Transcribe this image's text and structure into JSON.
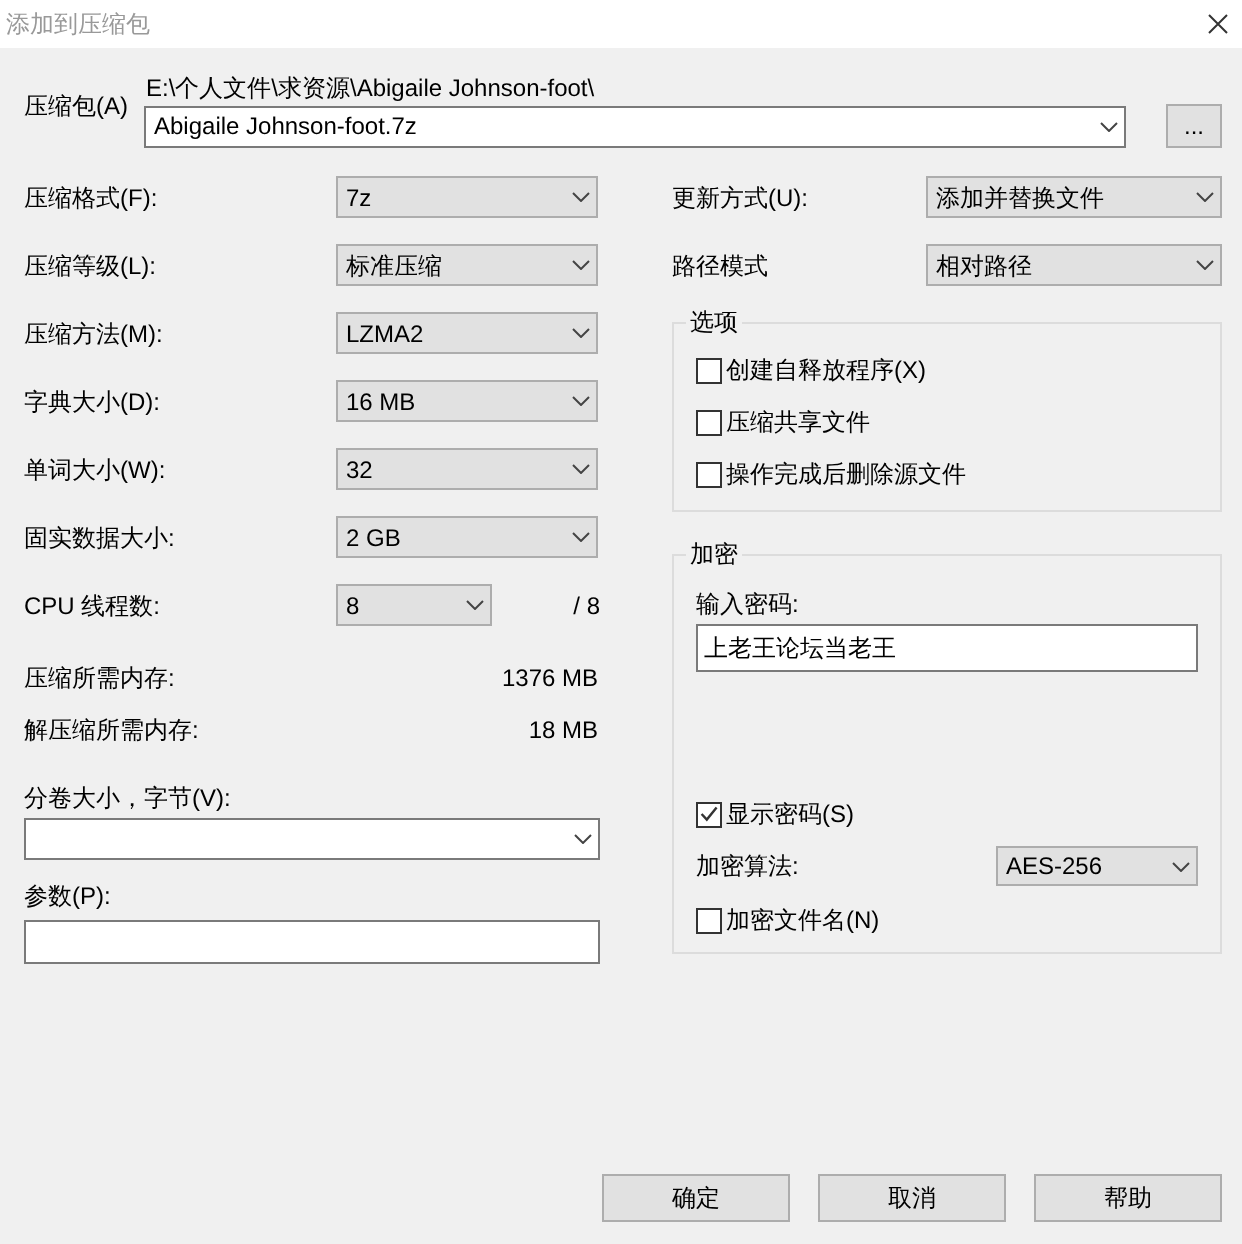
{
  "window": {
    "title": "添加到压缩包"
  },
  "archive": {
    "label": "压缩包(A)",
    "folder": "E:\\个人文件\\求资源\\Abigaile Johnson-foot\\",
    "file_name": "Abigaile Johnson-foot.7z",
    "browse_button": "..."
  },
  "compression_settings": [
    {
      "label": "压缩格式(F):",
      "value": "7z"
    },
    {
      "label": "压缩等级(L):",
      "value": "标准压缩"
    },
    {
      "label": "压缩方法(M):",
      "value": "LZMA2"
    },
    {
      "label": "字典大小(D):",
      "value": "16 MB"
    },
    {
      "label": "单词大小(W):",
      "value": "32"
    },
    {
      "label": "固实数据大小:",
      "value": "2 GB"
    },
    {
      "label": "CPU 线程数:",
      "value": "8",
      "maximum": "/ 8"
    }
  ],
  "memory_usage": [
    {
      "label": "压缩所需内存:",
      "value": "1376 MB"
    },
    {
      "label": "解压缩所需内存:",
      "value": "18 MB"
    }
  ],
  "split_volume": {
    "label": "分卷大小，字节(V):"
  },
  "parameters": {
    "label": "参数(P):"
  },
  "archive_settings": [
    {
      "label": "更新方式(U):",
      "value": "添加并替换文件"
    },
    {
      "label": "路径模式",
      "value": "相对路径"
    }
  ],
  "options": {
    "title": "选项",
    "items": [
      {
        "label": "创建自释放程序(X)",
        "checked": false
      },
      {
        "label": "压缩共享文件",
        "checked": false
      },
      {
        "label": "操作完成后删除源文件",
        "checked": false
      }
    ]
  },
  "encryption": {
    "title": "加密",
    "password_label": "输入密码:",
    "password": "上老王论坛当老王",
    "show_password": {
      "label": "显示密码(S)",
      "checked": true
    },
    "method_label": "加密算法:",
    "method": "AES-256",
    "encrypt_file_names": {
      "label": "加密文件名(N)",
      "checked": false
    }
  },
  "buttons": [
    {
      "label": "确定"
    },
    {
      "label": "取消"
    },
    {
      "label": "帮助"
    }
  ]
}
